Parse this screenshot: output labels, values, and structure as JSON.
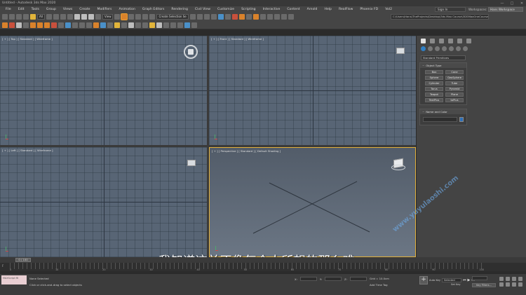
{
  "window": {
    "title": "Untitled - Autodesk 3ds Max 2020",
    "controls": [
      "—",
      "□",
      "✕"
    ]
  },
  "menu": {
    "items": [
      "File",
      "Edit",
      "Tools",
      "Group",
      "Views",
      "Create",
      "Modifiers",
      "Animation",
      "Graph Editors",
      "Rendering",
      "Civil View",
      "Customize",
      "Scripting",
      "Interactive",
      "Content",
      "Arnold",
      "Help",
      "RealFlow",
      "Phoenix FD",
      "Vol2"
    ],
    "signin": "Sign In",
    "workspace_label": "Workspaces:",
    "workspace_value": "Hans Workspace"
  },
  "toolbar": {
    "filter_dropdown": "All",
    "view_dropdown": "View",
    "selection_set": "Create Selection Se",
    "project_path": "C:\\Users\\Hans\\TheProjects\\Desktop\\3ds Max Course\\3DSMaxOneCourse"
  },
  "viewports": {
    "top_label": "[ + ] [ Top ] [ Standard ] [ Wireframe ]",
    "front_label": "[ + ] [ Front ] [ Standard ] [ Wireframe ]",
    "left_label": "[ + ] [ Left ] [ Standard ] [ Wireframe ]",
    "perspective_label": "[ + ] [ Perspective ] [ Standard ] [ Default Shading ]"
  },
  "command_panel": {
    "category_dropdown": "Standard Primitives",
    "object_type_header": "Object Type",
    "object_types": [
      "Box",
      "Cone",
      "Sphere",
      "GeoSphere",
      "Cylinder",
      "Tube",
      "Torus",
      "Pyramid",
      "Teapot",
      "Plane",
      "TextPlus",
      "toPlus"
    ],
    "name_color_header": "Name and Color"
  },
  "subtitle": "我知道这并不像每个人所想的那么难。",
  "watermark": "www.yuyulaoshi.com",
  "timeline": {
    "frame_slider": "0 / 100",
    "ticks": [
      "0",
      "10",
      "20",
      "30",
      "40",
      "50",
      "60",
      "70",
      "80",
      "90",
      "100"
    ]
  },
  "status": {
    "maxscript": "MAXScript Mi",
    "selection": "None Selected",
    "prompt": "Click or click-and-drag to select objects",
    "x_label": "X:",
    "y_label": "Y:",
    "z_label": "Z:",
    "grid": "Grid = 10.0cm",
    "add_time_tag": "Add Time Tag",
    "auto_key": "Auto Key",
    "set_key": "Set Key",
    "selected_dropdown": "Selected",
    "key_filters": "Key Filters..."
  }
}
